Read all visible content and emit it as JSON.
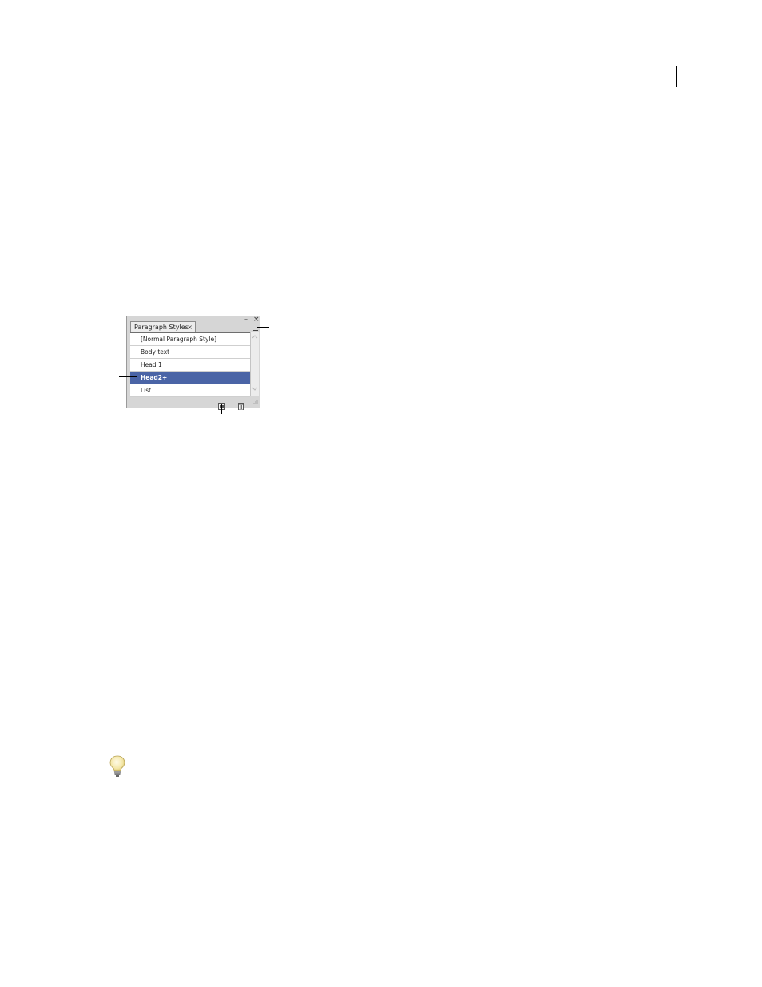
{
  "panel": {
    "tab_label": "Paragraph Styles",
    "tab_close_glyph": "×",
    "minimize_glyph": "–",
    "close_glyph": "×",
    "styles": [
      {
        "label": "[Normal Paragraph Style]",
        "selected": false
      },
      {
        "label": "Body text",
        "selected": false
      },
      {
        "label": "Head 1",
        "selected": false
      },
      {
        "label": "Head2+",
        "selected": true
      },
      {
        "label": "List",
        "selected": false
      }
    ],
    "selection_color": "#4a64a6",
    "icons": {
      "menu": "panel-menu-icon",
      "new_style": "create-new-style-icon",
      "delete_style": "delete-style-icon",
      "tip": "lightbulb-icon"
    }
  }
}
